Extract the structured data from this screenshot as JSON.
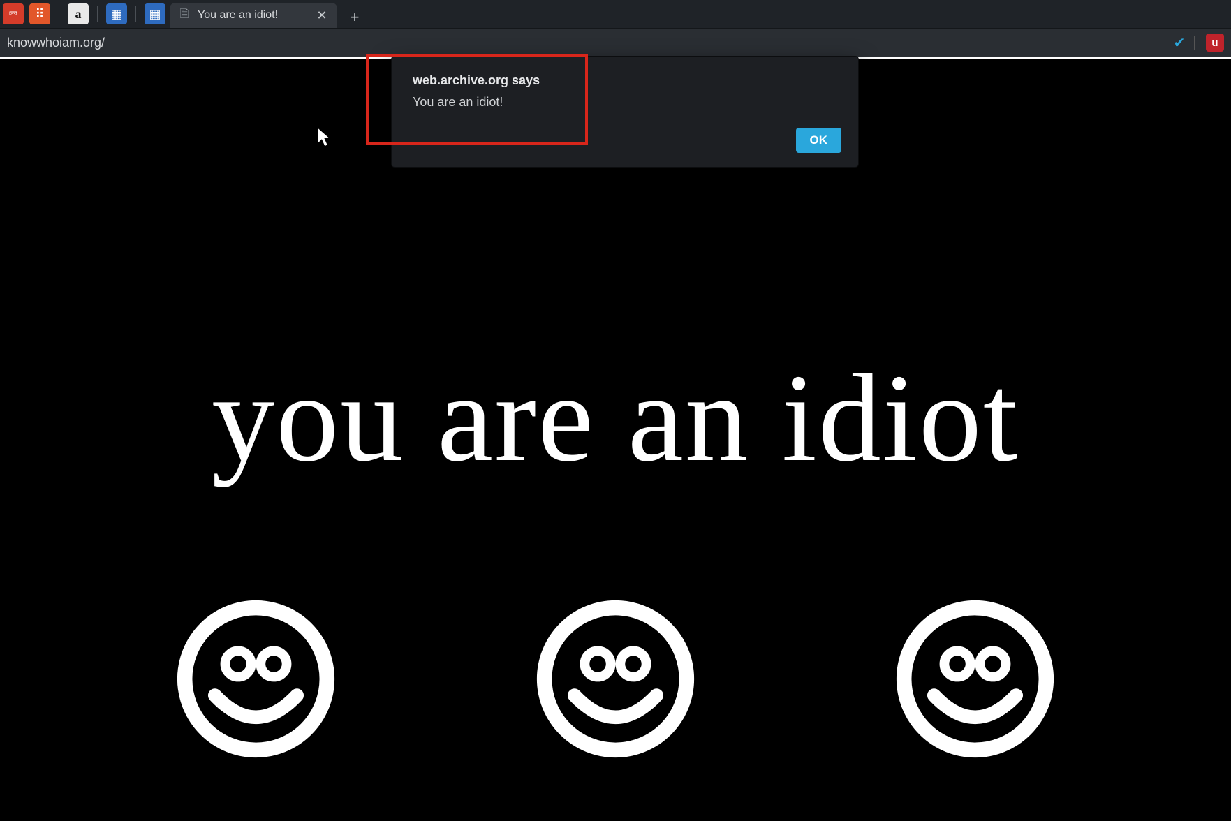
{
  "browser": {
    "pinned_tabs": [
      {
        "name": "pin-analytics",
        "glyph": "⮹",
        "bg": "pin-red"
      },
      {
        "name": "pin-grid",
        "glyph": "⠿",
        "bg": "pin-orange"
      },
      {
        "name": "pin-amazon",
        "glyph": "a",
        "bg": "pin-grey"
      },
      {
        "name": "pin-site-a",
        "glyph": "▦",
        "bg": "pin-blue"
      },
      {
        "name": "pin-site-b",
        "glyph": "▦",
        "bg": "pin-blue"
      }
    ],
    "active_tab": {
      "favicon_glyph": "🗎",
      "title": "You are an idiot!",
      "close_glyph": "✕"
    },
    "new_tab_glyph": "+",
    "url": "knowwhoiam.org/",
    "extensions": {
      "shield_glyph": "✔",
      "divider": "|",
      "red_label": "u"
    }
  },
  "page": {
    "headline": "you are an idiot",
    "smiley_count": 3
  },
  "alert": {
    "source": "web.archive.org says",
    "message": "You are an idiot!",
    "ok_label": "OK"
  },
  "colors": {
    "chrome_bg": "#1f2328",
    "addr_bg": "#2a2e33",
    "dialog_bg": "#1d1f23",
    "accent_blue": "#2aa7dc",
    "annotation_red": "#d8261b",
    "page_bg": "#000000",
    "page_fg": "#ffffff"
  }
}
